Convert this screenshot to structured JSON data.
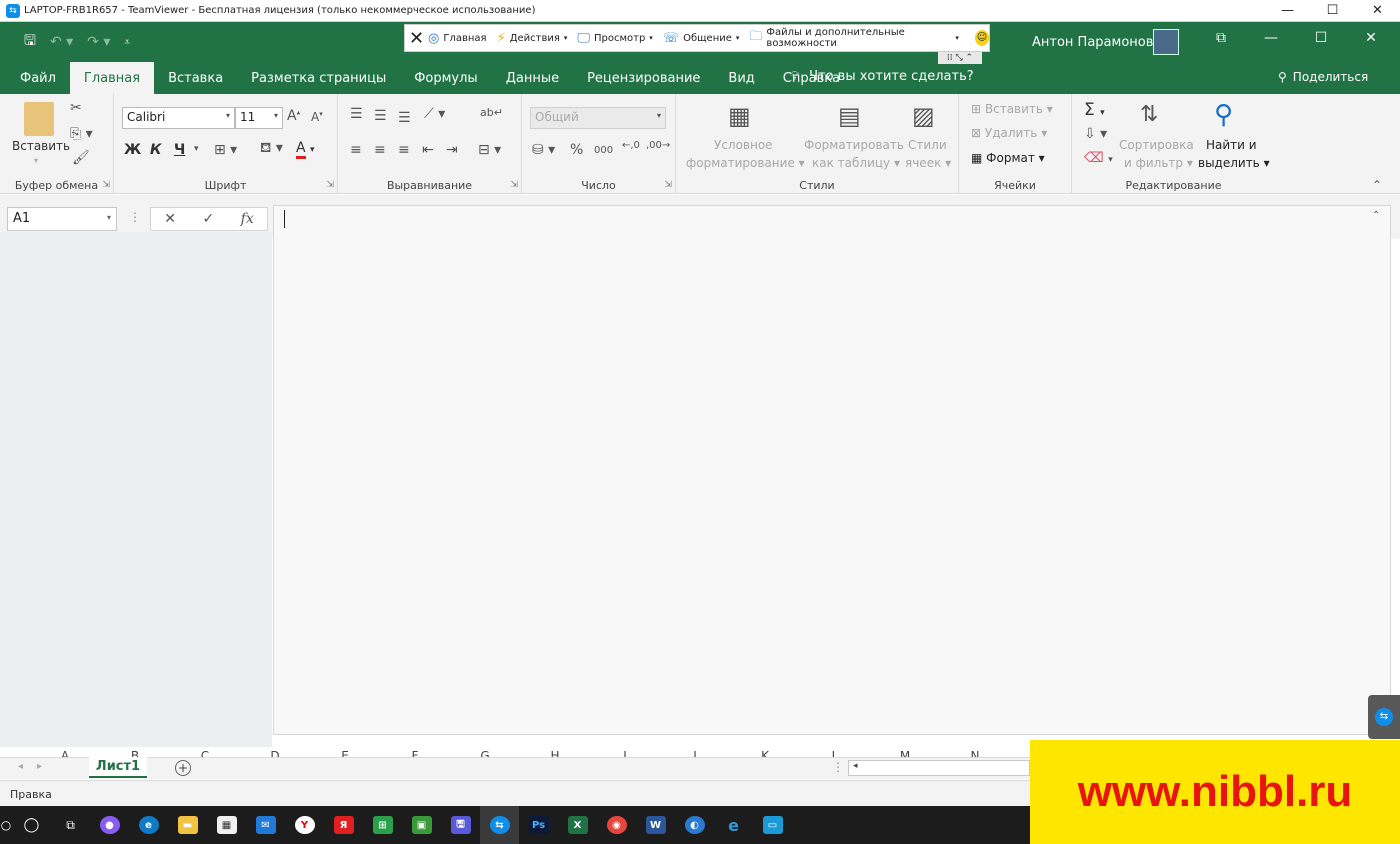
{
  "teamviewer": {
    "window_title": "LAPTOP-FRB1R657 - TeamViewer - Бесплатная лицензия (только некоммерческое использование)",
    "toolbar": {
      "home": "Главная",
      "actions": "Действия",
      "view": "Просмотр",
      "communicate": "Общение",
      "files": "Файлы и дополнительные возможности"
    }
  },
  "excel": {
    "user_name": "Антон Парамонов",
    "tabs": [
      "Файл",
      "Главная",
      "Вставка",
      "Разметка страницы",
      "Формулы",
      "Данные",
      "Рецензирование",
      "Вид",
      "Справка"
    ],
    "active_tab": "Главная",
    "tell_me": "Что вы хотите сделать?",
    "share": "Поделиться",
    "ribbon": {
      "clipboard": {
        "paste": "Вставить",
        "label": "Буфер обмена"
      },
      "font": {
        "name": "Calibri",
        "size": "11",
        "bold": "Ж",
        "italic": "К",
        "underline": "Ч",
        "label": "Шрифт"
      },
      "alignment": {
        "label": "Выравнивание"
      },
      "number": {
        "format": "Общий",
        "label": "Число"
      },
      "styles": {
        "conditional_1": "Условное",
        "conditional_2": "форматирование",
        "as_table_1": "Форматировать",
        "as_table_2": "как таблицу",
        "cell_styles_1": "Стили",
        "cell_styles_2": "ячеек",
        "label": "Стили"
      },
      "cells": {
        "insert": "Вставить",
        "delete": "Удалить",
        "format": "Формат",
        "label": "Ячейки"
      },
      "editing": {
        "sort_1": "Сортировка",
        "sort_2": "и фильтр",
        "find_1": "Найти и",
        "find_2": "выделить",
        "label": "Редактирование"
      }
    },
    "name_box": "A1",
    "columns": [
      "A",
      "B",
      "C",
      "D",
      "E",
      "F",
      "G",
      "H",
      "I",
      "J",
      "K",
      "L",
      "M",
      "N"
    ],
    "sheet_tab": "Лист1",
    "status": "Правка",
    "accent_color": "#217346"
  },
  "watermark": "www.nibbl.ru"
}
